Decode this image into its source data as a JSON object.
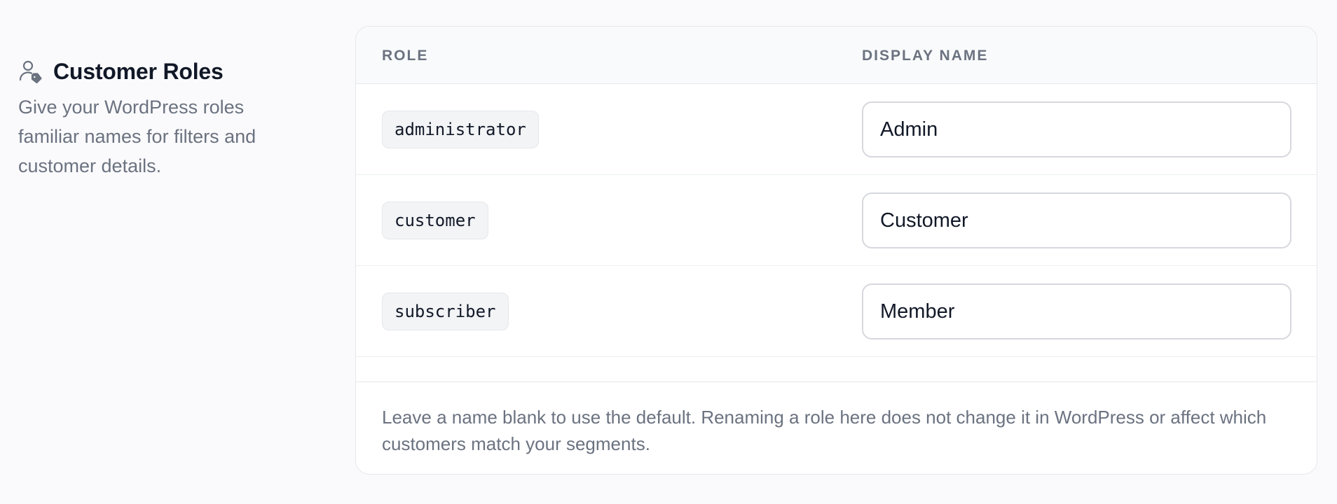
{
  "section": {
    "icon": "user-tag-icon",
    "title": "Customer Roles",
    "description": "Give your WordPress roles familiar names for filters and customer details."
  },
  "table": {
    "headers": {
      "role": "ROLE",
      "display_name": "DISPLAY NAME"
    },
    "rows": [
      {
        "role": "administrator",
        "display_name": "Admin"
      },
      {
        "role": "customer",
        "display_name": "Customer"
      },
      {
        "role": "subscriber",
        "display_name": "Member"
      }
    ],
    "note": "Leave a name blank to use the default. Renaming a role here does not change it in WordPress or affect which customers match your segments."
  },
  "colors": {
    "background": "#fafafc",
    "text_primary": "#111827",
    "text_muted": "#6b7280",
    "border": "#e5e7eb"
  }
}
